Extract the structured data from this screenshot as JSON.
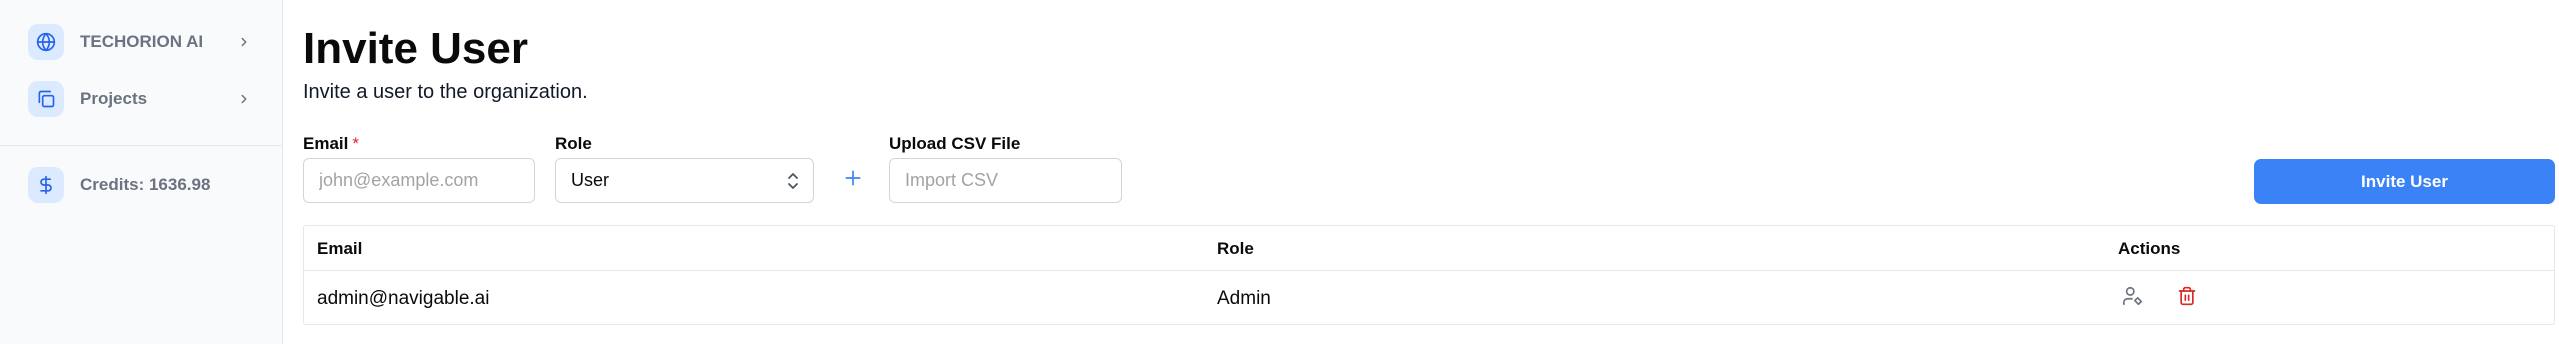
{
  "sidebar": {
    "items": [
      {
        "label": "TECHORION AI",
        "icon": "globe-icon",
        "has_chevron": true
      },
      {
        "label": "Projects",
        "icon": "folders-icon",
        "has_chevron": true
      }
    ],
    "credits": {
      "label": "Credits: 1636.98",
      "icon": "dollar-icon"
    }
  },
  "page": {
    "title": "Invite User",
    "subtitle": "Invite a user to the organization."
  },
  "form": {
    "email": {
      "label": "Email",
      "required_mark": "*",
      "placeholder": "john@example.com",
      "value": ""
    },
    "role": {
      "label": "Role",
      "selected": "User"
    },
    "upload": {
      "label": "Upload CSV File",
      "placeholder": "Import CSV"
    },
    "submit_label": "Invite User"
  },
  "table": {
    "columns": [
      "Email",
      "Role",
      "Actions"
    ],
    "rows": [
      {
        "email": "admin@navigable.ai",
        "role": "Admin",
        "actions": [
          "user-cog-icon",
          "trash-icon"
        ]
      }
    ]
  },
  "colors": {
    "accent": "#3b82f6",
    "danger": "#dc2626",
    "sidebar_bg": "#f8fafc",
    "icon_bg": "#dbeafe"
  }
}
